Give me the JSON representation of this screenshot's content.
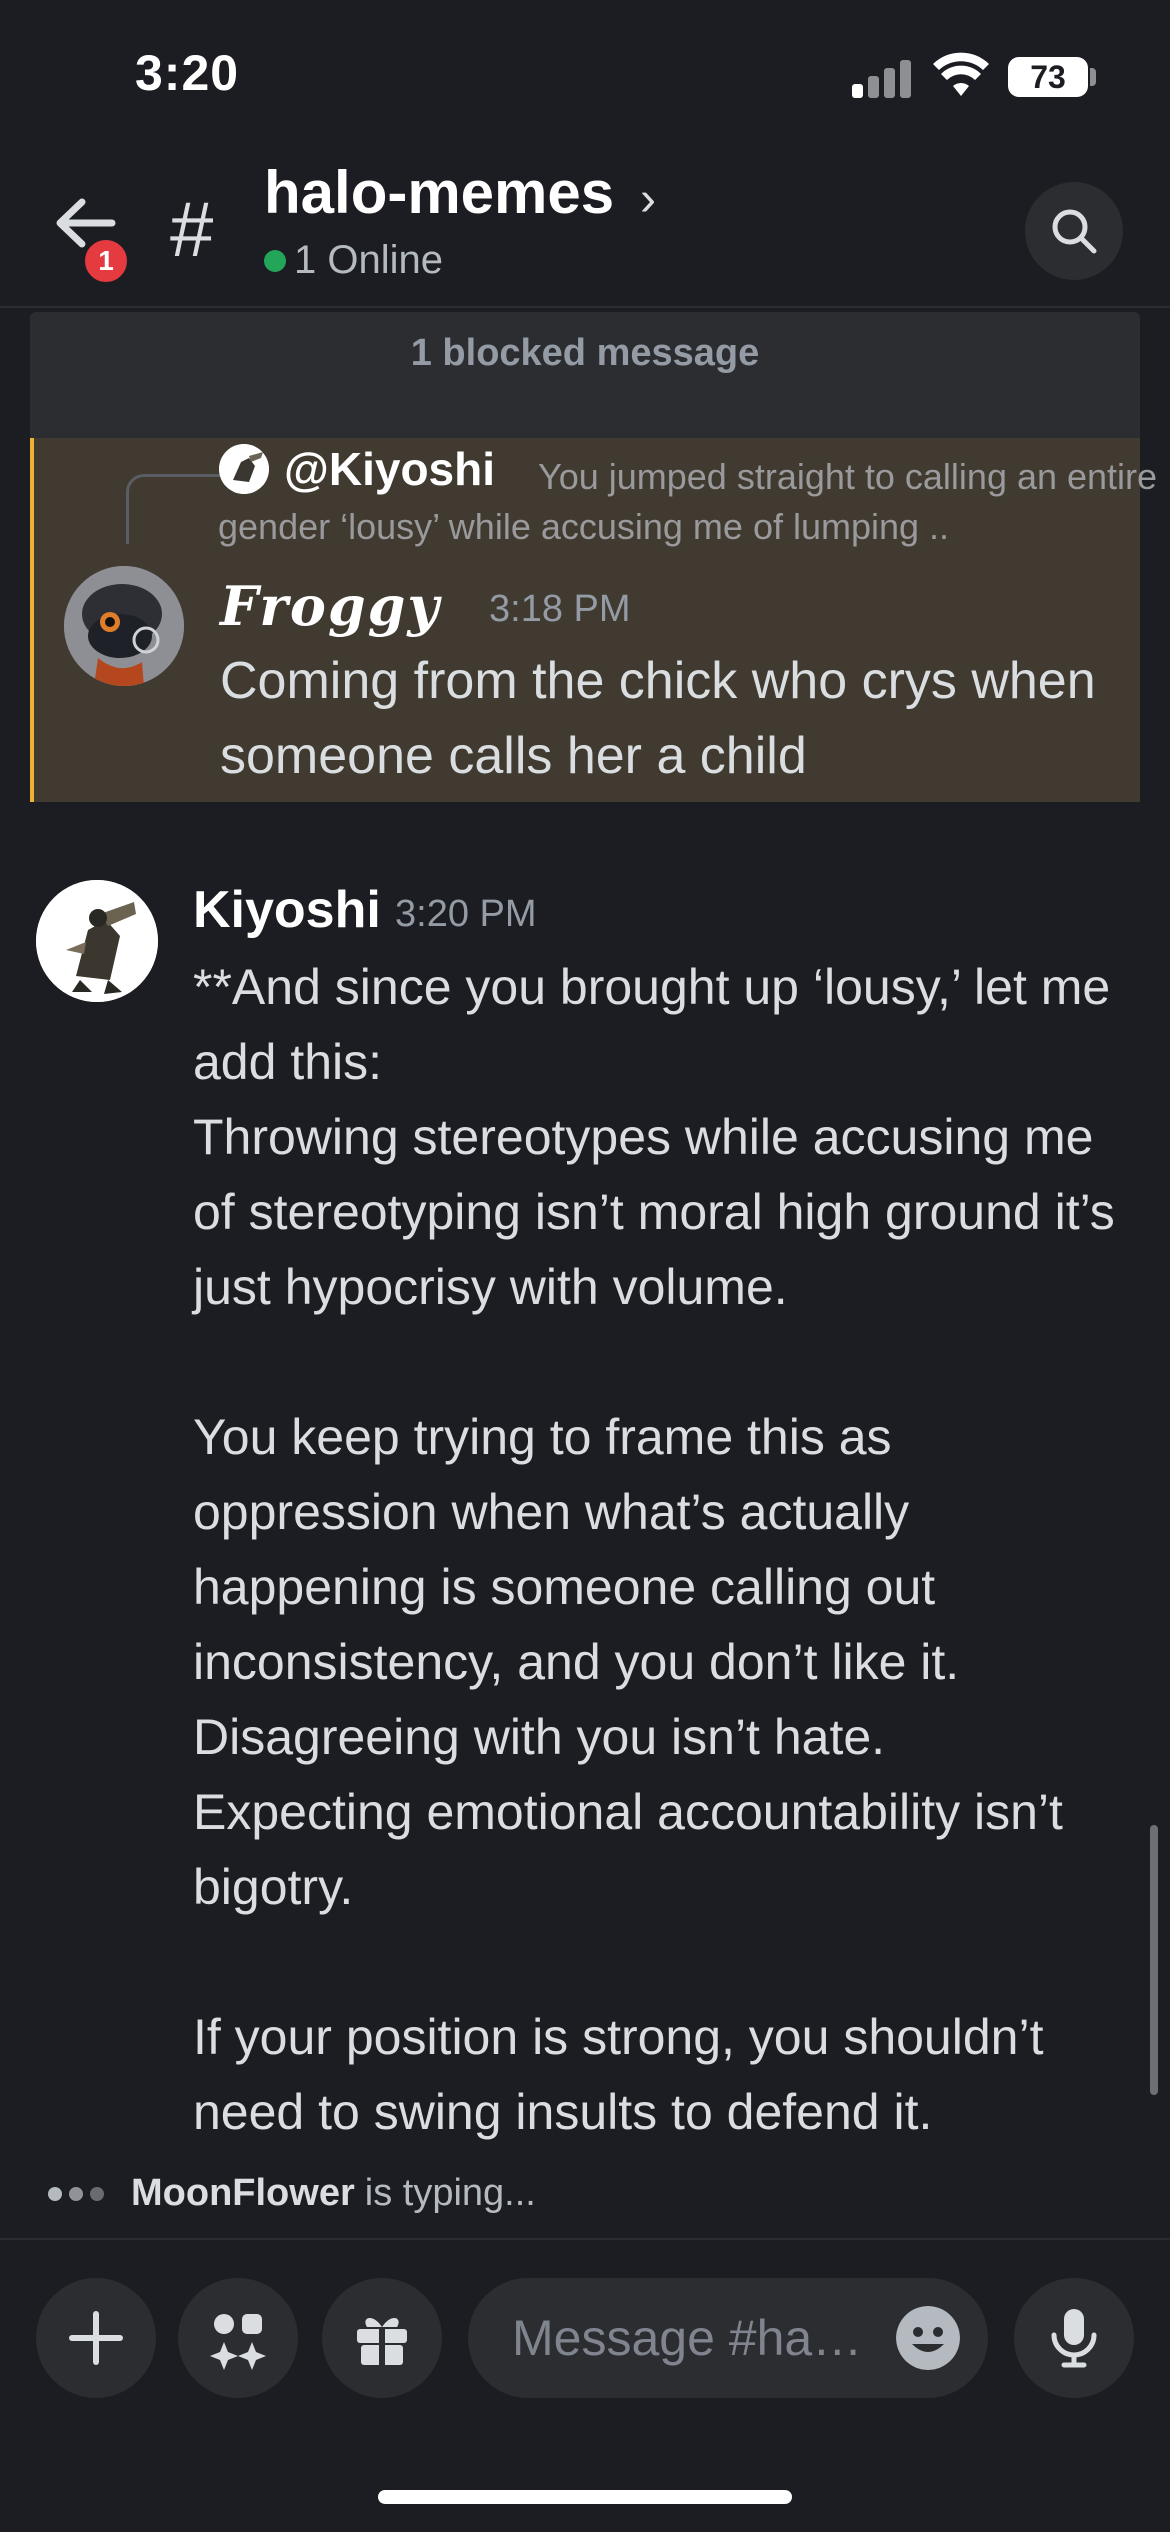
{
  "status_bar": {
    "time": "3:20",
    "battery": "73"
  },
  "header": {
    "back_badge": "1",
    "channel_name": "halo-memes",
    "online": "1 Online"
  },
  "blocked": {
    "text": "1 blocked message"
  },
  "reply": {
    "replied_user": "@Kiyoshi",
    "replied_snippet": "You jumped straight to calling an entire gender ‘lousy’ while accusing me of lumping ..",
    "author": "Froggy",
    "time": "3:18 PM",
    "text": "Coming from the chick who crys when someone calls her a child"
  },
  "message": {
    "author": "Kiyoshi",
    "time": "3:20 PM",
    "para1": "**And since you brought up ‘lousy,’ let me add this:",
    "para2": "Throwing stereotypes while accusing me of stereotyping isn’t moral high ground it’s just hypocrisy with volume.",
    "para3": "You keep trying to frame this as oppression when what’s actually happening is someone calling out inconsistency, and you don’t like it.",
    "para4": "Disagreeing with you isn’t hate.",
    "para5": "Expecting emotional accountability isn’t bigotry.",
    "para6": "If your position is strong, you shouldn’t need to swing insults to defend it."
  },
  "typing": {
    "user": "MoonFlower",
    "text": "is typing..."
  },
  "composer": {
    "placeholder": "Message #halo-memes"
  },
  "colors": {
    "background": "#1c1d22",
    "online": "#23a55a",
    "badge": "#e53a3f",
    "reply_highlight": "#403a31",
    "reply_border": "#f0b232"
  }
}
